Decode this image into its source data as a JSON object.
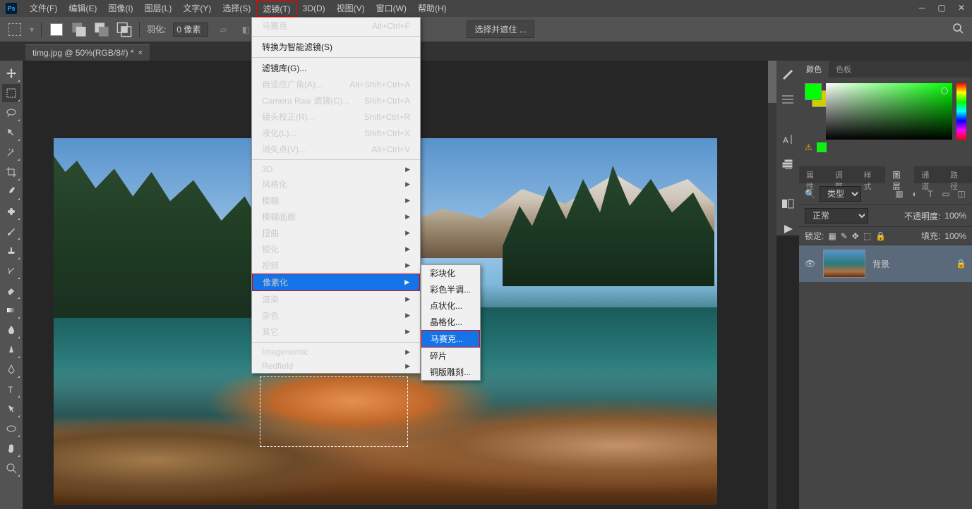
{
  "menubar": {
    "items": [
      "文件(F)",
      "编辑(E)",
      "图像(I)",
      "图层(L)",
      "文字(Y)",
      "选择(S)",
      "滤镜(T)",
      "3D(D)",
      "视图(V)",
      "窗口(W)",
      "帮助(H)"
    ]
  },
  "optbar": {
    "feather_label": "羽化:",
    "feather_value": "0 像素",
    "select_mask": "选择并遮住 ..."
  },
  "doc": {
    "title": "timg.jpg @ 50%(RGB/8#) *"
  },
  "filter_menu": {
    "last": {
      "label": "马赛克",
      "shortcut": "Alt+Ctrl+F"
    },
    "smart": "转换为智能滤镜(S)",
    "gallery": "滤镜库(G)...",
    "adaptive": {
      "label": "自适应广角(A)...",
      "shortcut": "Alt+Shift+Ctrl+A"
    },
    "cameraraw": {
      "label": "Camera Raw 滤镜(C)...",
      "shortcut": "Shift+Ctrl+A"
    },
    "lens": {
      "label": "镜头校正(R)...",
      "shortcut": "Shift+Ctrl+R"
    },
    "liquify": {
      "label": "液化(L)...",
      "shortcut": "Shift+Ctrl+X"
    },
    "vanish": {
      "label": "消失点(V)...",
      "shortcut": "Alt+Ctrl+V"
    },
    "sub": [
      "3D",
      "风格化",
      "模糊",
      "模糊画廊",
      "扭曲",
      "锐化",
      "视频",
      "像素化",
      "渲染",
      "杂色",
      "其它"
    ],
    "plugins": [
      "Imagenomic",
      "Redfield"
    ]
  },
  "pixelate_submenu": [
    "彩块化",
    "彩色半调...",
    "点状化...",
    "晶格化...",
    "马赛克...",
    "碎片",
    "铜版雕刻..."
  ],
  "right": {
    "tabs_top": [
      "颜色",
      "色板"
    ],
    "tabs_mid": [
      "属性",
      "调整",
      "样式",
      "图层",
      "通道",
      "路径"
    ],
    "kind_label": "类型",
    "blend": "正常",
    "opacity_label": "不透明度:",
    "opacity_value": "100%",
    "lock_label": "锁定:",
    "fill_label": "填充:",
    "fill_value": "100%",
    "layer_name": "背景"
  }
}
